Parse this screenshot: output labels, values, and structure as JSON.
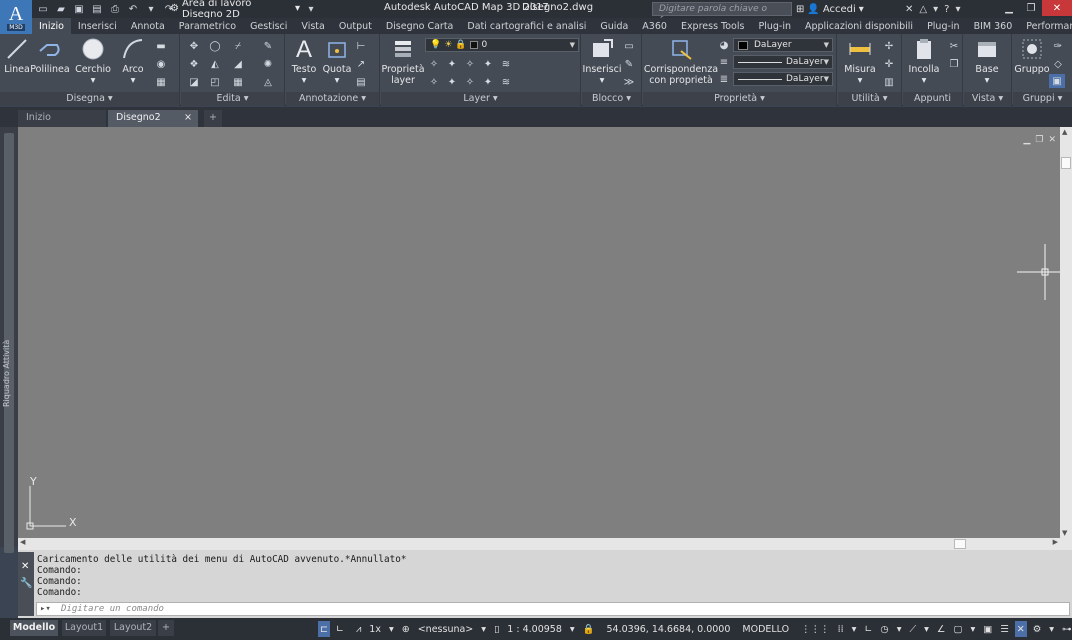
{
  "app": {
    "logo_letter": "A",
    "logo_sub": "M3D",
    "title": "Autodesk AutoCAD Map 3D 2017",
    "file": "Disegno2.dwg",
    "workspace": "Area di lavoro Disegno 2D",
    "search_placeholder": "Digitare parola chiave o frase",
    "signin": "Accedi"
  },
  "ribbon_tabs": [
    "Inizio",
    "Inserisci",
    "Annota",
    "Parametrico",
    "Gestisci",
    "Vista",
    "Output",
    "Disegno Carta",
    "Dati cartografici e analisi",
    "Guida",
    "A360",
    "Express Tools",
    "Plug-in",
    "Applicazioni disponibili",
    "Plug-in",
    "BIM 360",
    "Performance"
  ],
  "panels": {
    "draw": {
      "title": "Disegna ▾",
      "line": "Linea",
      "polyline": "Polilinea",
      "circle": "Cerchio",
      "arc": "Arco"
    },
    "modify": {
      "title": "Edita ▾"
    },
    "annotation": {
      "title": "Annotazione ▾",
      "text": "Testo",
      "dimension": "Quota"
    },
    "layers": {
      "title": "Layer ▾",
      "layer_props_1": "Proprietà",
      "layer_props_2": "layer",
      "current_layer": "0"
    },
    "block": {
      "title": "Blocco ▾",
      "insert": "Inserisci"
    },
    "properties": {
      "title": "Proprietà ▾",
      "match_1": "Corrispondenza",
      "match_2": "con proprietà",
      "color": "DaLayer",
      "linetype": "DaLayer",
      "lineweight": "DaLayer"
    },
    "utilities": {
      "title": "Utilità ▾",
      "measure": "Misura"
    },
    "clipboard": {
      "title": "Appunti",
      "paste": "Incolla"
    },
    "view": {
      "title": "Vista ▾",
      "base": "Base"
    },
    "groups": {
      "title": "Gruppi ▾",
      "group": "Gruppo"
    }
  },
  "file_tabs": {
    "home": "Inizio",
    "drawing": "Disegno2",
    "close": "×",
    "add": "+"
  },
  "left_palette_label": "Riquadro Attività",
  "ucs": {
    "x": "X",
    "y": "Y"
  },
  "command": {
    "history": [
      "Caricamento delle utilità dei menu di AutoCAD avvenuto.*Annullato*",
      "Comando:",
      "Comando:",
      "Comando:"
    ],
    "prompt": "▸▾",
    "placeholder": "Digitare un comando"
  },
  "layout_tabs": {
    "model": "Modello",
    "layout1": "Layout1",
    "layout2": "Layout2",
    "add": "+"
  },
  "status": {
    "scale_mult": "1x",
    "annot_scale": "<nessuna>",
    "scale": "1 : 4.00958",
    "coords": "54.0396, 14.6684, 0.0000",
    "space": "MODELLO"
  },
  "colors": {
    "accent": "#4c6fa8",
    "logo": "#3e77b8",
    "close": "#c8383a"
  }
}
